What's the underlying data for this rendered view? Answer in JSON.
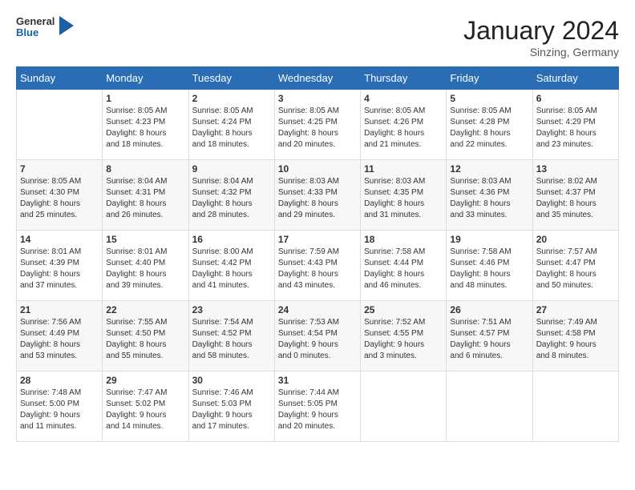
{
  "header": {
    "logo_line1": "General",
    "logo_line2": "Blue",
    "month": "January 2024",
    "location": "Sinzing, Germany"
  },
  "weekdays": [
    "Sunday",
    "Monday",
    "Tuesday",
    "Wednesday",
    "Thursday",
    "Friday",
    "Saturday"
  ],
  "weeks": [
    [
      {
        "day": "",
        "info": ""
      },
      {
        "day": "1",
        "info": "Sunrise: 8:05 AM\nSunset: 4:23 PM\nDaylight: 8 hours\nand 18 minutes."
      },
      {
        "day": "2",
        "info": "Sunrise: 8:05 AM\nSunset: 4:24 PM\nDaylight: 8 hours\nand 18 minutes."
      },
      {
        "day": "3",
        "info": "Sunrise: 8:05 AM\nSunset: 4:25 PM\nDaylight: 8 hours\nand 20 minutes."
      },
      {
        "day": "4",
        "info": "Sunrise: 8:05 AM\nSunset: 4:26 PM\nDaylight: 8 hours\nand 21 minutes."
      },
      {
        "day": "5",
        "info": "Sunrise: 8:05 AM\nSunset: 4:28 PM\nDaylight: 8 hours\nand 22 minutes."
      },
      {
        "day": "6",
        "info": "Sunrise: 8:05 AM\nSunset: 4:29 PM\nDaylight: 8 hours\nand 23 minutes."
      }
    ],
    [
      {
        "day": "7",
        "info": "Sunrise: 8:05 AM\nSunset: 4:30 PM\nDaylight: 8 hours\nand 25 minutes."
      },
      {
        "day": "8",
        "info": "Sunrise: 8:04 AM\nSunset: 4:31 PM\nDaylight: 8 hours\nand 26 minutes."
      },
      {
        "day": "9",
        "info": "Sunrise: 8:04 AM\nSunset: 4:32 PM\nDaylight: 8 hours\nand 28 minutes."
      },
      {
        "day": "10",
        "info": "Sunrise: 8:03 AM\nSunset: 4:33 PM\nDaylight: 8 hours\nand 29 minutes."
      },
      {
        "day": "11",
        "info": "Sunrise: 8:03 AM\nSunset: 4:35 PM\nDaylight: 8 hours\nand 31 minutes."
      },
      {
        "day": "12",
        "info": "Sunrise: 8:03 AM\nSunset: 4:36 PM\nDaylight: 8 hours\nand 33 minutes."
      },
      {
        "day": "13",
        "info": "Sunrise: 8:02 AM\nSunset: 4:37 PM\nDaylight: 8 hours\nand 35 minutes."
      }
    ],
    [
      {
        "day": "14",
        "info": "Sunrise: 8:01 AM\nSunset: 4:39 PM\nDaylight: 8 hours\nand 37 minutes."
      },
      {
        "day": "15",
        "info": "Sunrise: 8:01 AM\nSunset: 4:40 PM\nDaylight: 8 hours\nand 39 minutes."
      },
      {
        "day": "16",
        "info": "Sunrise: 8:00 AM\nSunset: 4:42 PM\nDaylight: 8 hours\nand 41 minutes."
      },
      {
        "day": "17",
        "info": "Sunrise: 7:59 AM\nSunset: 4:43 PM\nDaylight: 8 hours\nand 43 minutes."
      },
      {
        "day": "18",
        "info": "Sunrise: 7:58 AM\nSunset: 4:44 PM\nDaylight: 8 hours\nand 46 minutes."
      },
      {
        "day": "19",
        "info": "Sunrise: 7:58 AM\nSunset: 4:46 PM\nDaylight: 8 hours\nand 48 minutes."
      },
      {
        "day": "20",
        "info": "Sunrise: 7:57 AM\nSunset: 4:47 PM\nDaylight: 8 hours\nand 50 minutes."
      }
    ],
    [
      {
        "day": "21",
        "info": "Sunrise: 7:56 AM\nSunset: 4:49 PM\nDaylight: 8 hours\nand 53 minutes."
      },
      {
        "day": "22",
        "info": "Sunrise: 7:55 AM\nSunset: 4:50 PM\nDaylight: 8 hours\nand 55 minutes."
      },
      {
        "day": "23",
        "info": "Sunrise: 7:54 AM\nSunset: 4:52 PM\nDaylight: 8 hours\nand 58 minutes."
      },
      {
        "day": "24",
        "info": "Sunrise: 7:53 AM\nSunset: 4:54 PM\nDaylight: 9 hours\nand 0 minutes."
      },
      {
        "day": "25",
        "info": "Sunrise: 7:52 AM\nSunset: 4:55 PM\nDaylight: 9 hours\nand 3 minutes."
      },
      {
        "day": "26",
        "info": "Sunrise: 7:51 AM\nSunset: 4:57 PM\nDaylight: 9 hours\nand 6 minutes."
      },
      {
        "day": "27",
        "info": "Sunrise: 7:49 AM\nSunset: 4:58 PM\nDaylight: 9 hours\nand 8 minutes."
      }
    ],
    [
      {
        "day": "28",
        "info": "Sunrise: 7:48 AM\nSunset: 5:00 PM\nDaylight: 9 hours\nand 11 minutes."
      },
      {
        "day": "29",
        "info": "Sunrise: 7:47 AM\nSunset: 5:02 PM\nDaylight: 9 hours\nand 14 minutes."
      },
      {
        "day": "30",
        "info": "Sunrise: 7:46 AM\nSunset: 5:03 PM\nDaylight: 9 hours\nand 17 minutes."
      },
      {
        "day": "31",
        "info": "Sunrise: 7:44 AM\nSunset: 5:05 PM\nDaylight: 9 hours\nand 20 minutes."
      },
      {
        "day": "",
        "info": ""
      },
      {
        "day": "",
        "info": ""
      },
      {
        "day": "",
        "info": ""
      }
    ]
  ]
}
